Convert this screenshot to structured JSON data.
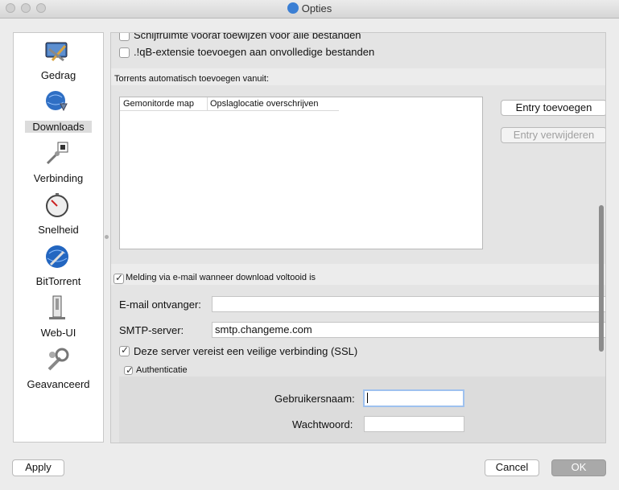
{
  "window": {
    "title": "Opties"
  },
  "sidebar": {
    "items": [
      {
        "label": "Gedrag",
        "icon": "gedrag-icon"
      },
      {
        "label": "Downloads",
        "icon": "downloads-icon",
        "selected": true
      },
      {
        "label": "Verbinding",
        "icon": "verbinding-icon"
      },
      {
        "label": "Snelheid",
        "icon": "snelheid-icon"
      },
      {
        "label": "BitTorrent",
        "icon": "bittorrent-icon"
      },
      {
        "label": "Web-UI",
        "icon": "web-ui-icon"
      },
      {
        "label": "Geavanceerd",
        "icon": "geavanceerd-icon"
      }
    ]
  },
  "downloads": {
    "prealloc_label": "Schijfruimte vooraf toewijzen voor alle bestanden",
    "prealloc_checked": false,
    "ext_label": ".!qB-extensie toevoegen aan onvolledige bestanden",
    "ext_checked": false,
    "auto_add_title": "Torrents automatisch toevoegen vanuit:",
    "table_columns": [
      "Gemonitorde map",
      "Opslaglocatie overschrijven"
    ],
    "add_entry": "Entry toevoegen",
    "remove_entry": "Entry verwijderen",
    "email_title": "Melding via e-mail wanneer download voltooid is",
    "email_checked": true,
    "email_recipient_label": "E-mail ontvanger:",
    "email_recipient_value": "",
    "smtp_label": "SMTP-server:",
    "smtp_value": "smtp.changeme.com",
    "ssl_label": "Deze server vereist een veilige verbinding (SSL)",
    "ssl_checked": true,
    "auth_title": "Authenticatie",
    "auth_checked": true,
    "username_label": "Gebruikersnaam:",
    "username_value": "",
    "password_label": "Wachtwoord:",
    "password_value": ""
  },
  "footer": {
    "apply": "Apply",
    "cancel": "Cancel",
    "ok": "OK"
  }
}
